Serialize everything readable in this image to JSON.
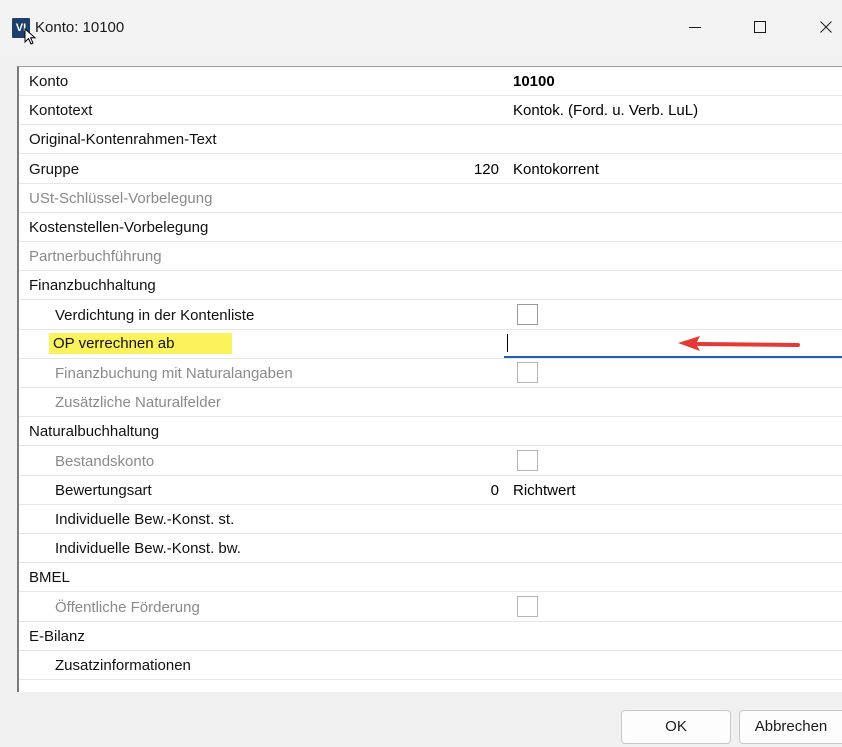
{
  "window": {
    "title": "Konto: 10100",
    "app_icon_text": "VI"
  },
  "table": {
    "rows": [
      {
        "label": "Konto",
        "level": 0,
        "disabled": false,
        "number": "",
        "value": "10100",
        "bold": true
      },
      {
        "label": "Kontotext",
        "level": 0,
        "disabled": false,
        "number": "",
        "value": "Kontok. (Ford. u. Verb. LuL)"
      },
      {
        "label": "Original-Kontenrahmen-Text",
        "level": 0,
        "disabled": false
      },
      {
        "label": "Gruppe",
        "level": 0,
        "disabled": false,
        "number": "120",
        "value": "Kontokorrent"
      },
      {
        "label": "USt-Schlüssel-Vorbelegung",
        "level": 0,
        "disabled": true
      },
      {
        "label": "Kostenstellen-Vorbelegung",
        "level": 0,
        "disabled": false
      },
      {
        "label": "Partnerbuchführung",
        "level": 0,
        "disabled": true
      },
      {
        "label": "Finanzbuchhaltung",
        "level": 0,
        "disabled": false
      },
      {
        "label": "Verdichtung in der Kontenliste",
        "level": 1,
        "disabled": false,
        "checkbox": true,
        "checked": false
      },
      {
        "label": "OP verrechnen ab",
        "level": 1,
        "disabled": false,
        "highlight": true,
        "edit": true,
        "edit_value": ""
      },
      {
        "label": "Finanzbuchung mit Naturalangaben",
        "level": 1,
        "disabled": true,
        "checkbox": true,
        "checked": false
      },
      {
        "label": "Zusätzliche Naturalfelder",
        "level": 1,
        "disabled": true
      },
      {
        "label": "Naturalbuchhaltung",
        "level": 0,
        "disabled": false
      },
      {
        "label": "Bestandskonto",
        "level": 1,
        "disabled": true,
        "checkbox": true,
        "checked": false
      },
      {
        "label": "Bewertungsart",
        "level": 1,
        "disabled": false,
        "number": "0",
        "value": "Richtwert"
      },
      {
        "label": "Individuelle Bew.-Konst. st.",
        "level": 1,
        "disabled": false
      },
      {
        "label": "Individuelle Bew.-Konst. bw.",
        "level": 1,
        "disabled": false
      },
      {
        "label": "BMEL",
        "level": 0,
        "disabled": false
      },
      {
        "label": "Öffentliche Förderung",
        "level": 1,
        "disabled": true,
        "checkbox": true,
        "checked": false
      },
      {
        "label": "E-Bilanz",
        "level": 0,
        "disabled": false
      },
      {
        "label": "Zusatzinformationen",
        "level": 1,
        "disabled": false
      }
    ]
  },
  "colors": {
    "highlight": "#fbf35c",
    "edit_underline": "#1f62b5",
    "annotation_arrow": "#e53935",
    "disabled_text": "#8a8a8a"
  },
  "buttons": {
    "ok": "OK",
    "cancel": "Abbrechen"
  }
}
